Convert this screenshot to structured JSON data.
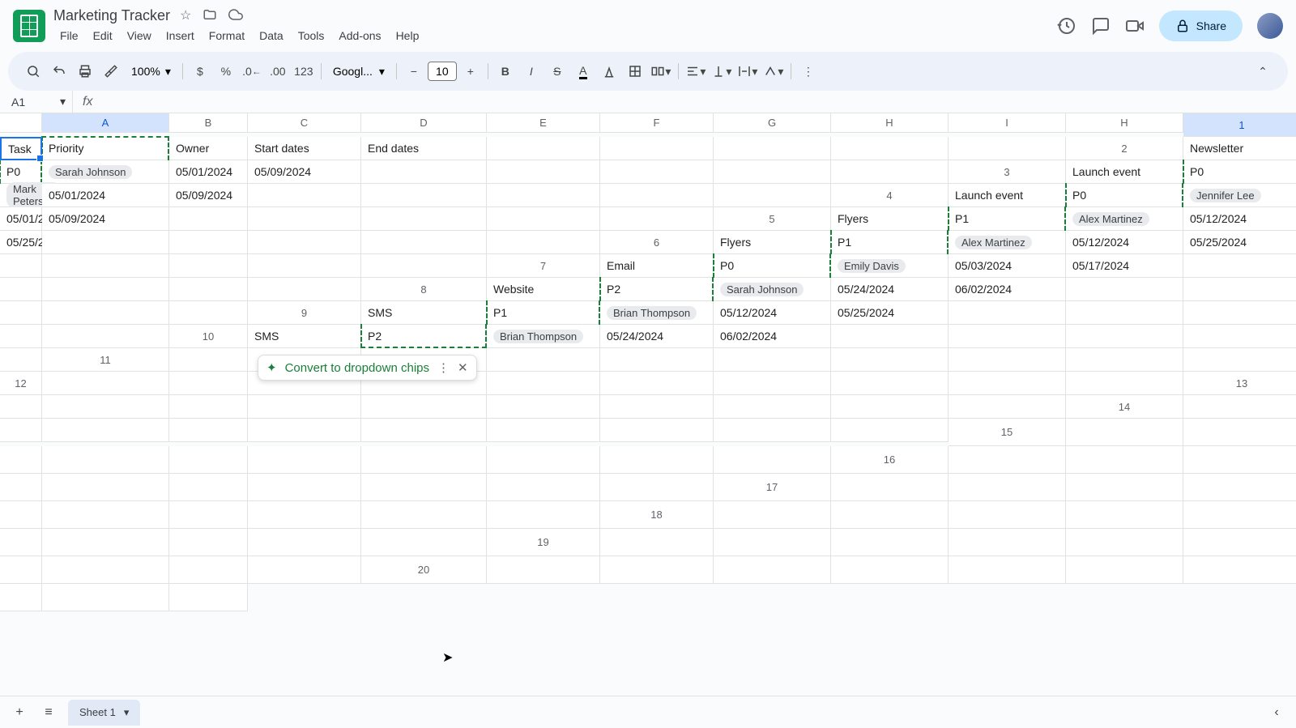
{
  "doc": {
    "title": "Marketing Tracker"
  },
  "menus": [
    "File",
    "Edit",
    "View",
    "Insert",
    "Format",
    "Data",
    "Tools",
    "Add-ons",
    "Help"
  ],
  "share": "Share",
  "toolbar": {
    "zoom": "100%",
    "font": "Googl...",
    "font_size": "10"
  },
  "name_box": "A1",
  "columns": [
    "A",
    "B",
    "C",
    "D",
    "E",
    "F",
    "G",
    "H",
    "I",
    "H"
  ],
  "row_count": 20,
  "headers": {
    "task": "Task",
    "priority": "Priority",
    "owner": "Owner",
    "start": "Start dates",
    "end": "End dates"
  },
  "rows": [
    {
      "task": "Newsletter",
      "priority": "P0",
      "owner": "Sarah Johnson",
      "start": "05/01/2024",
      "end": "05/09/2024"
    },
    {
      "task": "Launch event",
      "priority": "P0",
      "owner": "Mark Peterson",
      "start": "05/01/2024",
      "end": "05/09/2024"
    },
    {
      "task": "Launch event",
      "priority": "P0",
      "owner": "Jennifer Lee",
      "start": "05/01/2024",
      "end": "05/09/2024"
    },
    {
      "task": "Flyers",
      "priority": "P1",
      "owner": "Alex Martinez",
      "start": "05/12/2024",
      "end": "05/25/2024"
    },
    {
      "task": "Flyers",
      "priority": "P1",
      "owner": "Alex Martinez",
      "start": "05/12/2024",
      "end": "05/25/2024"
    },
    {
      "task": "Email",
      "priority": "P0",
      "owner": "Emily Davis",
      "start": "05/03/2024",
      "end": "05/17/2024"
    },
    {
      "task": "Website",
      "priority": "P2",
      "owner": "Sarah Johnson",
      "start": "05/24/2024",
      "end": "06/02/2024"
    },
    {
      "task": "SMS",
      "priority": "P1",
      "owner": "Brian Thompson",
      "start": "05/12/2024",
      "end": "05/25/2024"
    },
    {
      "task": "SMS",
      "priority": "P2",
      "owner": "Brian Thompson",
      "start": "05/24/2024",
      "end": "06/02/2024"
    }
  ],
  "popup": {
    "text": "Convert to dropdown chips"
  },
  "sheet_tab": "Sheet 1"
}
